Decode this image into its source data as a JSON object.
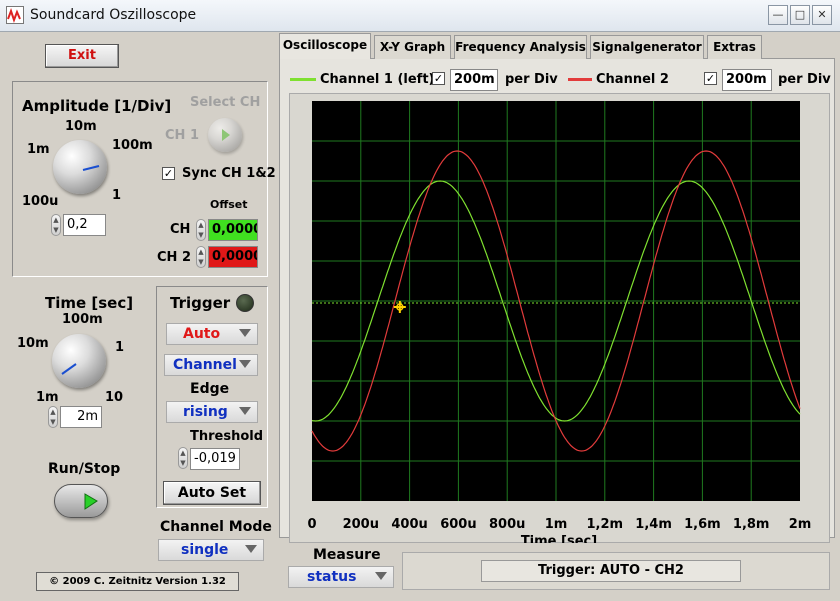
{
  "window": {
    "title": "Soundcard Oszilloscope",
    "min_label": "—",
    "max_label": "□",
    "close_label": "✕"
  },
  "left": {
    "exit_label": "Exit",
    "amplitude": {
      "title": "Amplitude [1/Div]",
      "labels": [
        "10m",
        "1m",
        "100m",
        "1",
        "100u"
      ],
      "value": "0,2"
    },
    "select_ch": {
      "title": "Select CH",
      "ch1_label": "CH 1"
    },
    "sync_label": "Sync CH 1&2",
    "offset": {
      "title": "Offset",
      "ch1_label": "CH",
      "ch1_value": "0,0000",
      "ch2_label": "CH 2",
      "ch2_value": "0,0000"
    },
    "time": {
      "title": "Time [sec]",
      "labels": [
        "100m",
        "10m",
        "1",
        "1m",
        "10"
      ],
      "value": "2m"
    },
    "run_stop_label": "Run/Stop",
    "trigger": {
      "title": "Trigger",
      "mode": "Auto",
      "source": "Channel",
      "edge_title": "Edge",
      "edge": "rising",
      "threshold_title": "Threshold",
      "threshold_value": "-0,019",
      "auto_set_label": "Auto Set"
    },
    "channel_mode": {
      "title": "Channel Mode",
      "value": "single"
    },
    "copyright": "© 2009   C. Zeitnitz Version 1.32"
  },
  "tabs": [
    "Oscilloscope",
    "X-Y Graph",
    "Frequency Analysis",
    "Signalgenerator",
    "Extras"
  ],
  "legend": {
    "ch1_name": "Channel 1 (left)",
    "ch1_value": "200m",
    "ch2_name": "Channel 2",
    "ch2_value": "200m",
    "per_div": "per Div"
  },
  "colors": {
    "ch1": "#7fe030",
    "ch2": "#e23b3b",
    "screen": "#000000",
    "grid": "#1f7a1f",
    "trigger_marker": "#ffd200",
    "offset_ch1_bg": "#40e020",
    "offset_ch2_bg": "#e01818"
  },
  "chart_data": {
    "type": "line",
    "x_tick_labels": [
      "0",
      "200u",
      "400u",
      "600u",
      "800u",
      "1m",
      "1,2m",
      "1,4m",
      "1,6m",
      "1,8m",
      "2m"
    ],
    "xlabel": "Time [sec]",
    "xlim": [
      0,
      0.002
    ],
    "ylim": [
      -1,
      1
    ],
    "grid": true,
    "series": [
      {
        "name": "Channel 1 (left)",
        "color": "#7fe030",
        "amplitude": 0.6,
        "period": 0.00102,
        "phase_peak_at": 0.000525,
        "offset": 0
      },
      {
        "name": "Channel 2",
        "color": "#e23b3b",
        "amplitude": 0.75,
        "period": 0.00102,
        "phase_peak_at": 0.000595,
        "offset": 0
      }
    ],
    "trigger_level": 0,
    "trigger_point_x": 0.00036
  },
  "measure": {
    "title": "Measure",
    "value": "status"
  },
  "status_text": "Trigger: AUTO - CH2"
}
